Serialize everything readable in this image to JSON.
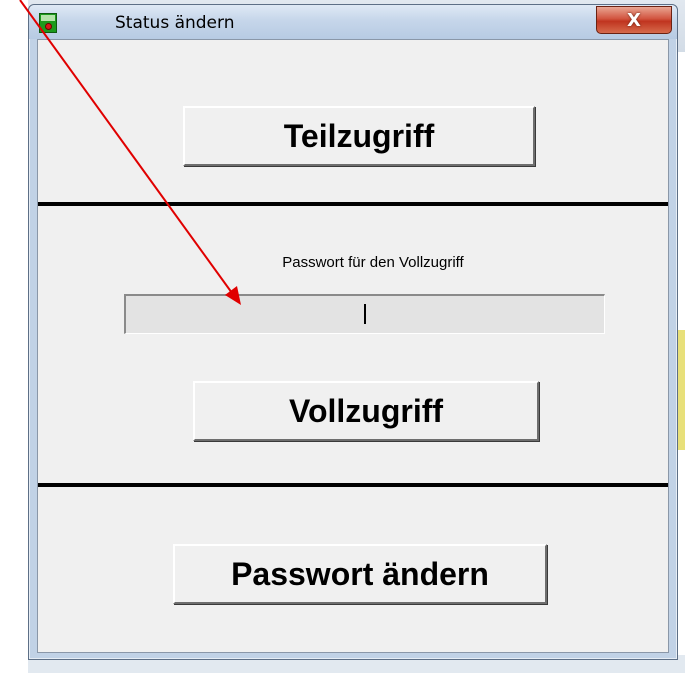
{
  "window": {
    "title": "Status ändern",
    "close_label": "X",
    "app_icon": "application-icon"
  },
  "buttons": {
    "teilzugriff": "Teilzugriff",
    "vollzugriff": "Vollzugriff",
    "passwort_aendern": "Passwort ändern"
  },
  "password": {
    "label": "Passwort für den Vollzugriff",
    "value": ""
  },
  "annotation": {
    "arrow_color": "#e00000"
  }
}
